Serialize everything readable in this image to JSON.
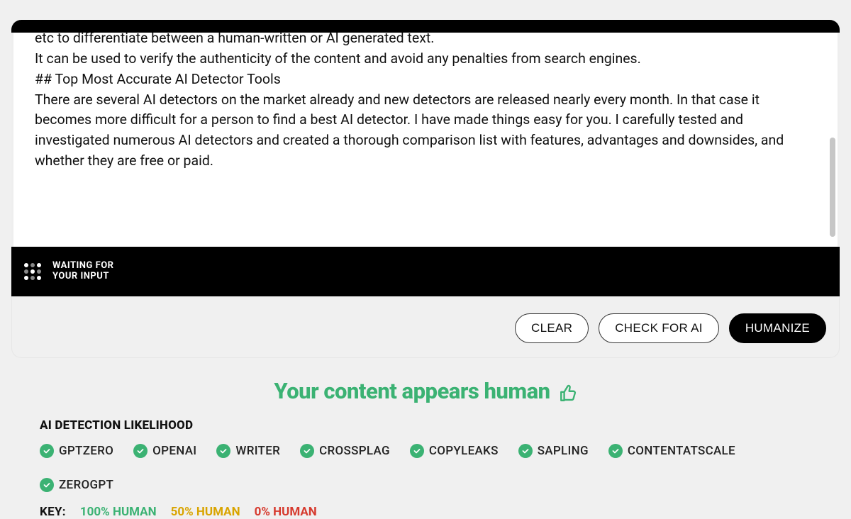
{
  "editor": {
    "line_partial": "etc to differentiate between a human-written or AI generated text.",
    "para2": "It can be used to verify the authenticity of the content and avoid any penalties from search engines.",
    "heading": "## Top Most Accurate AI Detector Tools",
    "para3": "There are several AI detectors on the market already and new detectors are released nearly every month. In that case it becomes more difficult for a person to find a best AI detector. I have made things easy for you. I carefully tested and investigated numerous AI detectors and created a thorough comparison list with features, advantages and downsides, and whether they are free or paid."
  },
  "status": {
    "line1": "WAITING FOR",
    "line2": "YOUR INPUT"
  },
  "buttons": {
    "clear": "CLEAR",
    "check": "CHECK FOR AI",
    "humanize": "HUMANIZE"
  },
  "result": {
    "headline": "Your content appears human",
    "likelihood_label": "AI DETECTION LIKELIHOOD",
    "detectors": [
      "GPTZERO",
      "OPENAI",
      "WRITER",
      "CROSSPLAG",
      "COPYLEAKS",
      "SAPLING",
      "CONTENTATSCALE",
      "ZEROGPT"
    ],
    "key_label": "KEY:",
    "key": {
      "green": "100% HUMAN",
      "amber": "50% HUMAN",
      "red": "0% HUMAN"
    }
  },
  "colors": {
    "green": "#3bb273",
    "amber": "#d9a400",
    "red": "#d63a2e"
  }
}
